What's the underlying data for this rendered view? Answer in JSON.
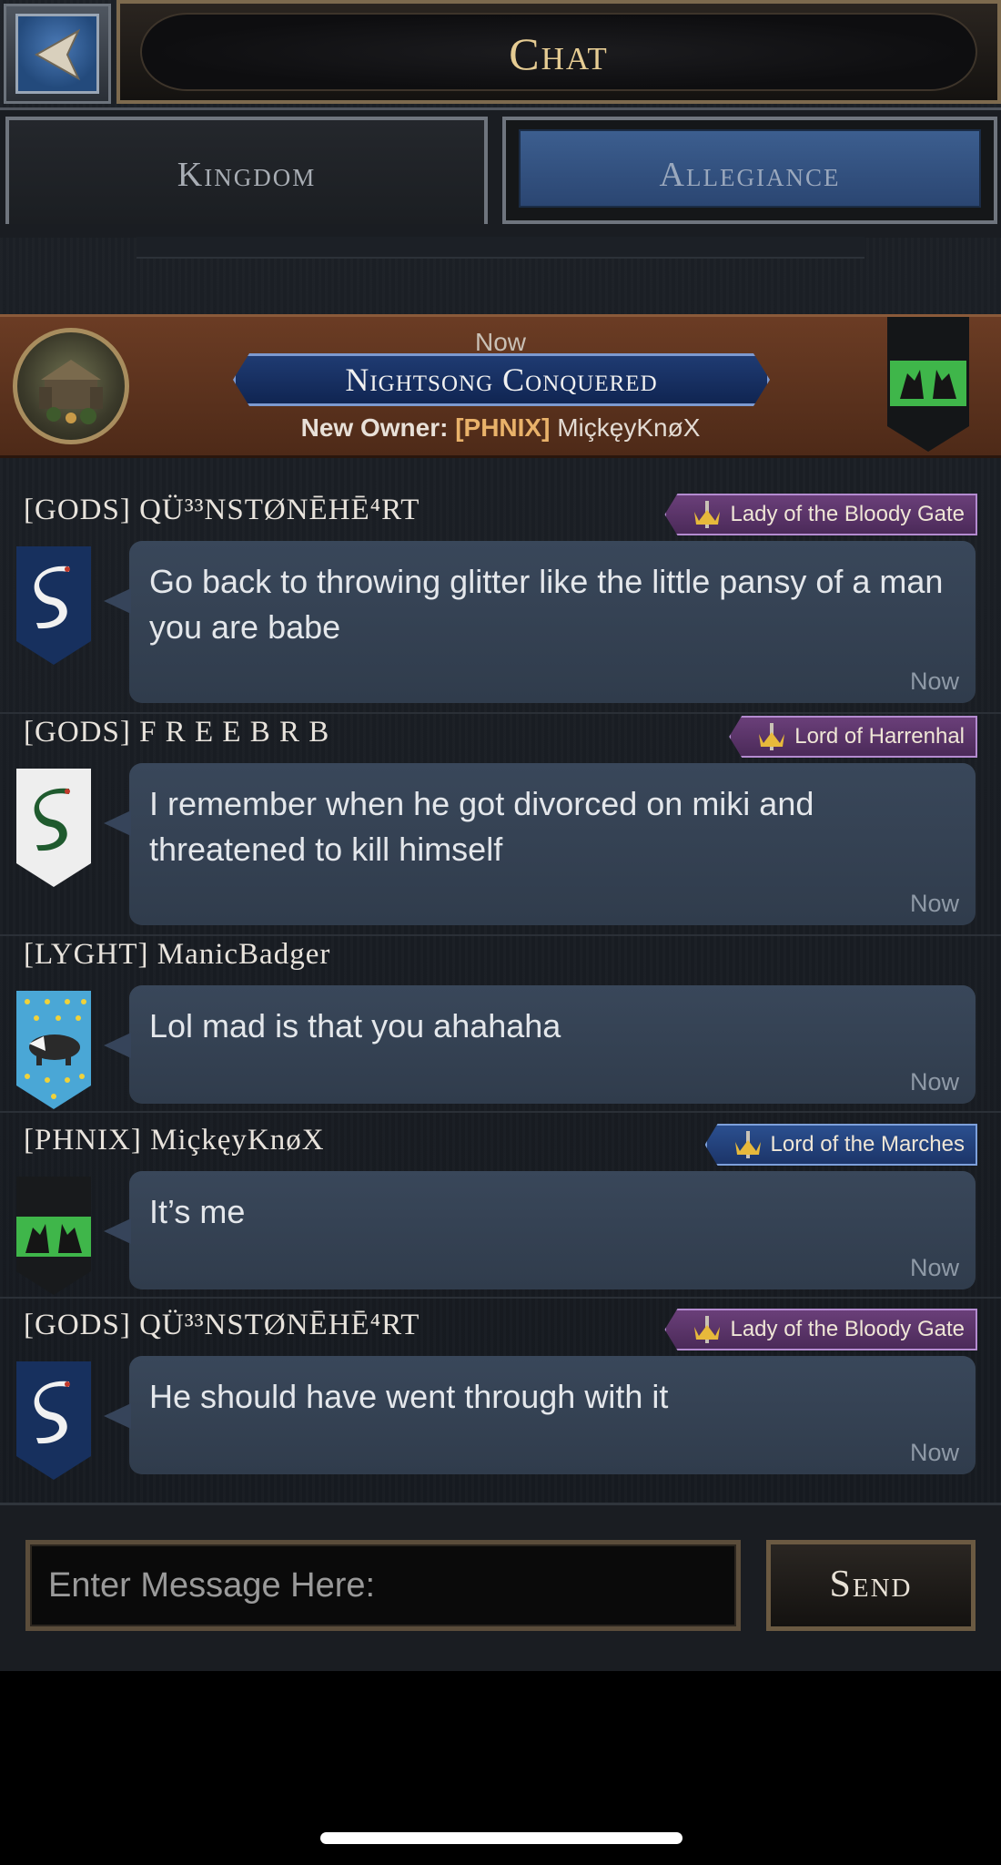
{
  "header": {
    "title": "Chat",
    "back_icon": "back-arrow-icon"
  },
  "tabs": [
    {
      "label": "Kingdom",
      "selected": true
    },
    {
      "label": "Allegiance",
      "selected": false
    }
  ],
  "announcement": {
    "time": "Now",
    "title": "Nightsong Conquered",
    "owner_label": "New Owner:",
    "owner_tag": "[PHNIX]",
    "owner_name": "MiçkęyKnøX",
    "icon": "castle-icon",
    "banner_icon": "green-griffin-banner-icon"
  },
  "messages": [
    {
      "sender": "[GODS] QÜ³³NSTØNĒHĒ⁴RT",
      "badge": "Lady of the Bloody Gate",
      "badge_color": "#6a3f79",
      "text": "Go back to throwing glitter like the little pansy of a man you are babe",
      "time": "Now",
      "sigil": "snake-sigil-blue"
    },
    {
      "sender": "[GODS] F R E E   B R B",
      "badge": "Lord of Harrenhal",
      "badge_color": "#6a3f79",
      "text": "I remember when he got divorced on miki and threatened to kill himself",
      "time": "Now",
      "sigil": "snake-sigil-white"
    },
    {
      "sender": "[LYGHT] ManicBadger",
      "badge": "",
      "text": "Lol mad is that you ahahaha",
      "time": "Now",
      "sigil": "badger-sigil"
    },
    {
      "sender": "[PHNIX] MiçkęyKnøX",
      "badge": "Lord of the Marches",
      "badge_color": "#2b4f8f",
      "text": "It’s me",
      "time": "Now",
      "sigil": "griffin-sigil-green"
    },
    {
      "sender": "[GODS] QÜ³³NSTØNĒHĒ⁴RT",
      "badge": "Lady of the Bloody Gate",
      "badge_color": "#6a3f79",
      "text": "He should have went through with it",
      "time": "Now",
      "sigil": "snake-sigil-blue"
    }
  ],
  "composer": {
    "placeholder": "Enter Message Here:",
    "value": "",
    "send_label": "Send"
  },
  "colors": {
    "title_gold": "#e6cc93",
    "allegiance_blue": "#3c5e8f",
    "bubble": "#36445a",
    "announce_brown": "#6b3c24"
  }
}
